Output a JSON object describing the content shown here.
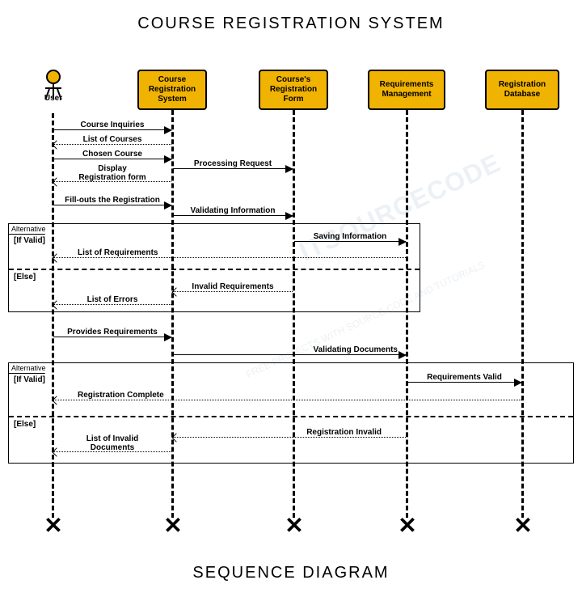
{
  "title": "COURSE REGISTRATION SYSTEM",
  "subtitle": "SEQUENCE DIAGRAM",
  "actor": {
    "label": "User"
  },
  "lifelines": [
    {
      "label": "Course\nRegistration\nSystem"
    },
    {
      "label": "Course's\nRegistration\nForm"
    },
    {
      "label": "Requirements\nManagement"
    },
    {
      "label": "Registration\nDatabase"
    }
  ],
  "messages": {
    "m1": "Course Inquiries",
    "m2": "List of Courses",
    "m3": "Chosen Course",
    "m4": "Processing Request",
    "m5": "Display\nRegistration form",
    "m6": "Fill-outs the Registration",
    "m7": "Validating Information",
    "m8": "Saving Information",
    "m9": "List of Requirements",
    "m10": "Invalid Requirements",
    "m11": "List of Errors",
    "m12": "Provides Requirements",
    "m13": "Validating Documents",
    "m14": "Requirements  Valid",
    "m15": "Registration Complete",
    "m16": "Registration Invalid",
    "m17": "List of Invalid\nDocuments"
  },
  "fragments": {
    "alt": "Alternative",
    "ifvalid": "[If Valid]",
    "else": "[Else]"
  },
  "watermark": "ITSOURCECODE",
  "watermark_sub": "FREE PROJECTS WITH SOURCE CODE AND TUTORIALS"
}
